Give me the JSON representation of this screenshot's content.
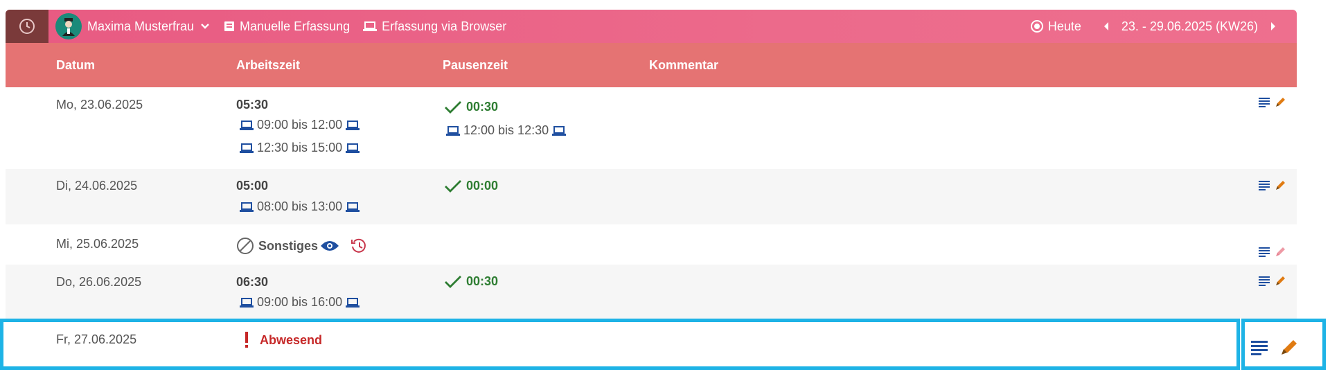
{
  "toolbar": {
    "user_name": "Maxima Musterfrau",
    "manual_entry": "Manuelle Erfassung",
    "browser_entry": "Erfassung via Browser",
    "today": "Heute",
    "week_range": "23. - 29.06.2025 (KW26)"
  },
  "table": {
    "headers": {
      "date": "Datum",
      "work": "Arbeitszeit",
      "pause": "Pausenzeit",
      "comment": "Kommentar"
    },
    "rows": [
      {
        "date": "Mo, 23.06.2025",
        "work_total": "05:30",
        "work_ranges": [
          "09:00 bis 12:00",
          "12:30 bis 15:00"
        ],
        "pause_total": "00:30",
        "pause_ranges": [
          "12:00 bis 12:30"
        ]
      },
      {
        "date": "Di, 24.06.2025",
        "work_total": "05:00",
        "work_ranges": [
          "08:00 bis 13:00"
        ],
        "pause_total": "00:00"
      },
      {
        "date": "Mi, 25.06.2025",
        "status": "Sonstiges"
      },
      {
        "date": "Do, 26.06.2025",
        "work_total": "06:30",
        "work_ranges": [
          "09:00 bis 16:00"
        ],
        "pause_total": "00:30"
      },
      {
        "date": "Fr, 27.06.2025",
        "status": "Abwesend"
      }
    ]
  },
  "colors": {
    "topbar": "#ec6a8b",
    "header": "#e57373",
    "green": "#2e7d32",
    "laptop": "#1f4fa0",
    "highlight": "#1eb3e6"
  }
}
